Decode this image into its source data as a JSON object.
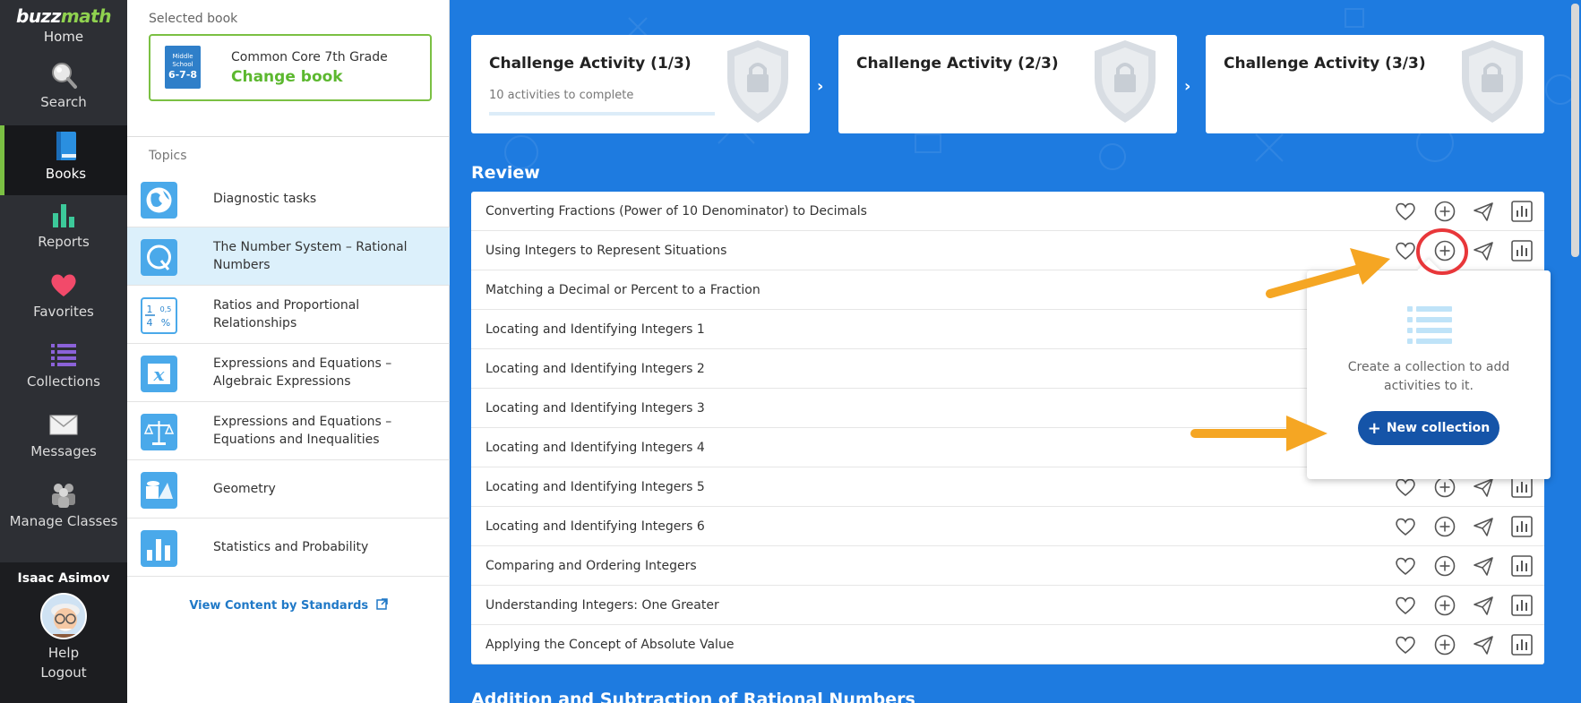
{
  "nav": {
    "logo_b": "buzz",
    "logo_m": "math",
    "home": "Home",
    "items": [
      {
        "label": "Search",
        "icon": "search-icon"
      },
      {
        "label": "Books",
        "icon": "book-icon"
      },
      {
        "label": "Reports",
        "icon": "bar-chart-icon"
      },
      {
        "label": "Favorites",
        "icon": "heart-icon"
      },
      {
        "label": "Collections",
        "icon": "list-icon"
      },
      {
        "label": "Messages",
        "icon": "envelope-icon"
      },
      {
        "label": "Manage Classes",
        "icon": "users-icon"
      }
    ],
    "active": "Books",
    "user_name": "Isaac Asimov",
    "help": "Help",
    "logout": "Logout"
  },
  "book_panel": {
    "selected_label": "Selected book",
    "book_title": "Common Core 7th Grade",
    "change_book": "Change book",
    "cover_line1": "Middle",
    "cover_line2": "School",
    "cover_grades": "6-7-8",
    "topics_label": "Topics",
    "topics": [
      {
        "label": "Diagnostic tasks",
        "icon": "globe-icon"
      },
      {
        "label": "The Number System – Rational Numbers",
        "icon": "q-icon",
        "active": true
      },
      {
        "label": "Ratios and Proportional Relationships",
        "icon": "fraction-icon"
      },
      {
        "label": "Expressions and Equations – Algebraic Expressions",
        "icon": "x-variable-icon"
      },
      {
        "label": "Expressions and Equations – Equations and Inequalities",
        "icon": "balance-scale-icon"
      },
      {
        "label": "Geometry",
        "icon": "shapes-icon"
      },
      {
        "label": "Statistics and Probability",
        "icon": "bar-chart-icon"
      }
    ],
    "fraction_top": "1",
    "fraction_bottom": "4",
    "fraction_decimal": "0,5",
    "fraction_percent": "%",
    "x_variable": "x",
    "standards_link": "View Content by Standards"
  },
  "challenges": [
    {
      "title": "Challenge Activity (1/3)",
      "subtitle": "10 activities to complete",
      "progress": 0
    },
    {
      "title": "Challenge Activity (2/3)"
    },
    {
      "title": "Challenge Activity (3/3)"
    }
  ],
  "review": {
    "title": "Review",
    "rows": [
      "Converting Fractions (Power of 10 Denominator) to Decimals",
      "Using Integers to Represent Situations",
      "Matching a Decimal or Percent to a Fraction",
      "Locating and Identifying Integers 1",
      "Locating and Identifying Integers 2",
      "Locating and Identifying Integers 3",
      "Locating and Identifying Integers 4",
      "Locating and Identifying Integers 5",
      "Locating and Identifying Integers 6",
      "Comparing and Ordering Integers",
      "Understanding Integers: One Greater",
      "Applying the Concept of Absolute Value"
    ],
    "row_actions": [
      "heart-icon",
      "plus-circle-icon",
      "send-icon",
      "report-icon"
    ]
  },
  "next_section_title": "Addition and Subtraction of Rational Numbers",
  "popup": {
    "text": "Create a collection to add activities to it.",
    "button": "New collection"
  },
  "colors": {
    "brand_green": "#7bc043",
    "main_blue": "#1e7be0",
    "button_blue": "#1554a8",
    "annotation_orange": "#f5a623",
    "annotation_red": "#e8373a"
  }
}
